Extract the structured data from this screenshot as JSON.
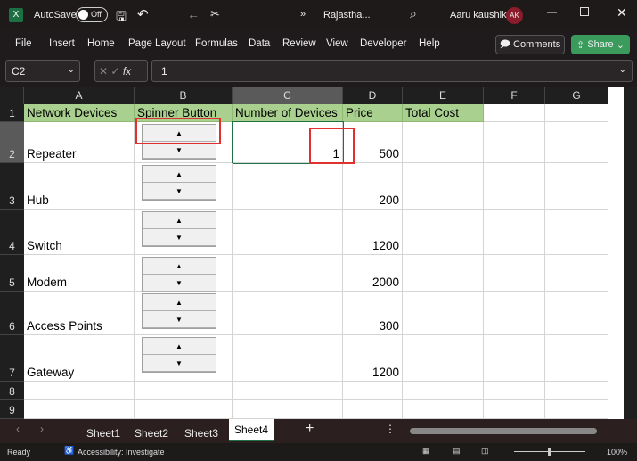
{
  "titlebar": {
    "autosave_label": "AutoSave",
    "autosave_state": "Off",
    "file_name": "Rajastha...",
    "user_name": "Aaru kaushik",
    "avatar_initials": "AK",
    "more": "»"
  },
  "menu": {
    "items": [
      "File",
      "Insert",
      "Home",
      "Page Layout",
      "Formulas",
      "Data",
      "Review",
      "View",
      "Developer",
      "Help"
    ],
    "comments": "Comments",
    "share": "Share"
  },
  "formula_bar": {
    "name_box": "C2",
    "fx": "fx",
    "value": "1"
  },
  "columns": [
    "A",
    "B",
    "C",
    "D",
    "E",
    "F",
    "G"
  ],
  "rows": [
    {
      "num": "1",
      "cells": [
        "Network Devices",
        "Spinner Button",
        "Number of Devices",
        "Price",
        "Total Cost"
      ]
    },
    {
      "num": "2",
      "cells": [
        "Repeater",
        "",
        "1",
        "500",
        ""
      ]
    },
    {
      "num": "3",
      "cells": [
        "Hub",
        "",
        "",
        "200",
        ""
      ]
    },
    {
      "num": "4",
      "cells": [
        "Switch",
        "",
        "",
        "1200",
        ""
      ]
    },
    {
      "num": "5",
      "cells": [
        "Modem",
        "",
        "",
        "2000",
        ""
      ]
    },
    {
      "num": "6",
      "cells": [
        "Access Points",
        "",
        "",
        "300",
        ""
      ]
    },
    {
      "num": "7",
      "cells": [
        "Gateway",
        "",
        "",
        "1200",
        ""
      ]
    },
    {
      "num": "8",
      "cells": []
    },
    {
      "num": "9",
      "cells": []
    }
  ],
  "spinner": {
    "up": "▲",
    "down": "▼"
  },
  "sheets": [
    "Sheet1",
    "Sheet2",
    "Sheet3",
    "Sheet4"
  ],
  "active_sheet": "Sheet4",
  "status": {
    "ready": "Ready",
    "accessibility": "Accessibility: Investigate",
    "zoom": "100%"
  },
  "colors": {
    "header_fill": "#a9d08e",
    "highlight": "#e03030",
    "share": "#3a9b5c",
    "avatar": "#8b1c2c"
  }
}
